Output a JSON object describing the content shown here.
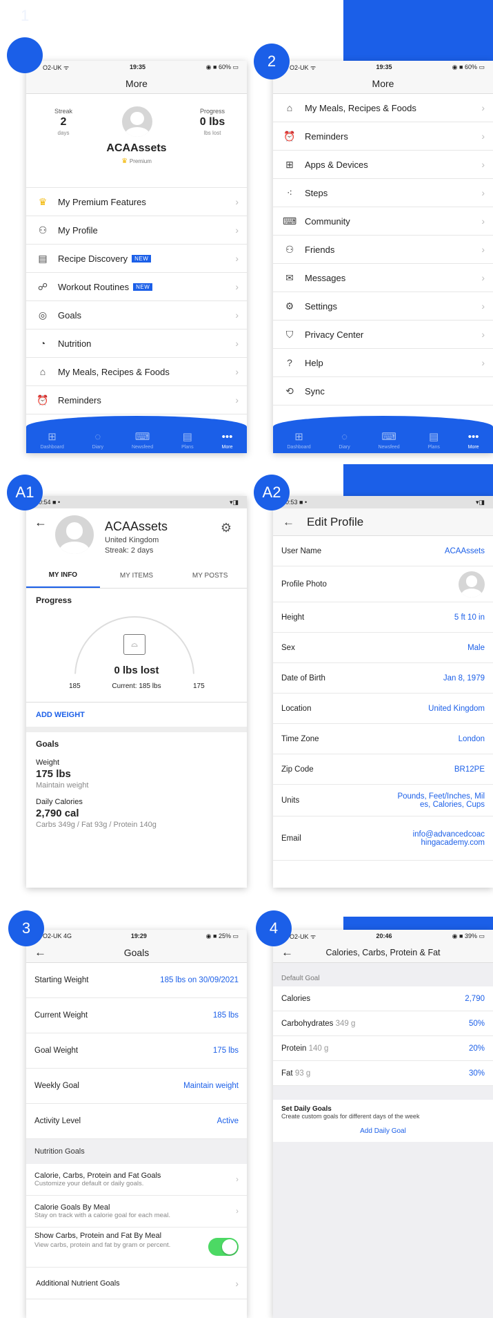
{
  "badges": {
    "b1": "",
    "b2": "2",
    "a1": "A1",
    "a2": "A2",
    "b3": "3",
    "b4": "4"
  },
  "corner_digit": "1",
  "colors": {
    "accent": "#1b5fe8",
    "toggle": "#4cd964"
  },
  "s1": {
    "status": {
      "left": "O2-UK ᯤ",
      "time": "19:35",
      "right": "◉ ■ 60% ▭"
    },
    "title": "More",
    "streak": {
      "label": "Streak",
      "value": "2",
      "unit": "days"
    },
    "progress": {
      "label": "Progress",
      "value": "0 lbs",
      "unit": "lbs lost"
    },
    "username": "ACAAssets",
    "premium": "Premium",
    "items": [
      {
        "icon": "crown-icon",
        "glyph": "♛",
        "label": "My Premium Features",
        "badge": ""
      },
      {
        "icon": "person-icon",
        "glyph": "⚇",
        "label": "My Profile",
        "badge": ""
      },
      {
        "icon": "recipe-icon",
        "glyph": "▤",
        "label": "Recipe Discovery",
        "badge": "NEW"
      },
      {
        "icon": "workout-icon",
        "glyph": "☍",
        "label": "Workout Routines",
        "badge": "NEW"
      },
      {
        "icon": "target-icon",
        "glyph": "◎",
        "label": "Goals",
        "badge": ""
      },
      {
        "icon": "nutrition-icon",
        "glyph": "◔",
        "label": "Nutrition",
        "badge": ""
      },
      {
        "icon": "house-icon",
        "glyph": "⌂",
        "label": "My Meals, Recipes & Foods",
        "badge": ""
      },
      {
        "icon": "alarm-icon",
        "glyph": "⏰",
        "label": "Reminders",
        "badge": ""
      }
    ]
  },
  "s2": {
    "status": {
      "left": "O2-UK ᯤ",
      "time": "19:35",
      "right": "◉ ■ 60% ▭"
    },
    "title": "More",
    "items": [
      {
        "icon": "house-icon",
        "glyph": "⌂",
        "label": "My Meals, Recipes & Foods"
      },
      {
        "icon": "alarm-icon",
        "glyph": "⏰",
        "label": "Reminders"
      },
      {
        "icon": "apps-icon",
        "glyph": "⊞",
        "label": "Apps & Devices"
      },
      {
        "icon": "steps-icon",
        "glyph": "⁖",
        "label": "Steps"
      },
      {
        "icon": "community-icon",
        "glyph": "⌨",
        "label": "Community"
      },
      {
        "icon": "friends-icon",
        "glyph": "⚇",
        "label": "Friends"
      },
      {
        "icon": "mail-icon",
        "glyph": "✉",
        "label": "Messages"
      },
      {
        "icon": "gear-icon",
        "glyph": "⚙",
        "label": "Settings"
      },
      {
        "icon": "shield-icon",
        "glyph": "⛉",
        "label": "Privacy Center"
      },
      {
        "icon": "help-icon",
        "glyph": "?",
        "label": "Help"
      },
      {
        "icon": "sync-icon",
        "glyph": "⟲",
        "label": "Sync"
      }
    ]
  },
  "tabs": [
    {
      "icon": "dashboard-icon",
      "glyph": "⊞",
      "label": "Dashboard"
    },
    {
      "icon": "diary-icon",
      "glyph": "◌",
      "label": "Diary"
    },
    {
      "icon": "newsfeed-icon",
      "glyph": "⌨",
      "label": "Newsfeed"
    },
    {
      "icon": "plans-icon",
      "glyph": "▤",
      "label": "Plans"
    },
    {
      "icon": "more-icon",
      "glyph": "•••",
      "label": "More"
    }
  ],
  "a1": {
    "status": {
      "left": "0:54 ■ •",
      "right": "▾◨"
    },
    "name": "ACAAssets",
    "country": "United Kingdom",
    "streak": "Streak: 2 days",
    "tabs": [
      "MY INFO",
      "MY ITEMS",
      "MY POSTS"
    ],
    "progress_title": "Progress",
    "lost": "0 lbs lost",
    "start": "185",
    "current": "Current: 185 lbs",
    "goal": "175",
    "add_weight": "ADD WEIGHT",
    "goals_title": "Goals",
    "weight_label": "Weight",
    "weight_value": "175 lbs",
    "weight_sub": "Maintain weight",
    "cal_label": "Daily Calories",
    "cal_value": "2,790 cal",
    "cal_sub": "Carbs 349g / Fat 93g / Protein 140g"
  },
  "a2": {
    "status": {
      "left": "0:53 ■ •",
      "right": "▾◨"
    },
    "title": "Edit Profile",
    "rows": [
      {
        "label": "User Name",
        "value": "ACAAssets"
      },
      {
        "label": "Profile Photo",
        "value": ""
      },
      {
        "label": "Height",
        "value": "5 ft 10 in"
      },
      {
        "label": "Sex",
        "value": "Male"
      },
      {
        "label": "Date of Birth",
        "value": "Jan 8, 1979"
      },
      {
        "label": "Location",
        "value": "United Kingdom"
      },
      {
        "label": "Time Zone",
        "value": "London"
      },
      {
        "label": "Zip Code",
        "value": "BR12PE"
      },
      {
        "label": "Units",
        "value": "Pounds, Feet/Inches, Miles, Calories, Cups"
      },
      {
        "label": "Email",
        "value": "info@advancedcoachingacademy.com"
      }
    ]
  },
  "s3": {
    "status": {
      "left": "O2-UK 4G",
      "time": "19:29",
      "right": "◉ ■ 25% ▭"
    },
    "title": "Goals",
    "rows": [
      {
        "label": "Starting Weight",
        "value": "185 lbs on 30/09/2021"
      },
      {
        "label": "Current Weight",
        "value": "185 lbs"
      },
      {
        "label": "Goal Weight",
        "value": "175 lbs"
      },
      {
        "label": "Weekly Goal",
        "value": "Maintain weight"
      },
      {
        "label": "Activity Level",
        "value": "Active"
      }
    ],
    "nutrition_header": "Nutrition Goals",
    "nrows": [
      {
        "title": "Calorie, Carbs, Protein and Fat Goals",
        "sub": "Customize your default or daily goals."
      },
      {
        "title": "Calorie Goals By Meal",
        "sub": "Stay on track with a calorie goal for each meal."
      }
    ],
    "toggle_title": "Show Carbs, Protein and Fat By Meal",
    "toggle_sub": "View carbs, protein and fat by gram or percent.",
    "toggle_on": true,
    "additional": "Additional Nutrient Goals"
  },
  "s4": {
    "status": {
      "left": "O2-UK ᯤ",
      "time": "20:46",
      "right": "◉ ■ 39% ▭"
    },
    "title": "Calories, Carbs, Protein & Fat",
    "default_goal": "Default Goal",
    "rows": [
      {
        "label": "Calories",
        "sub": "",
        "value": "2,790"
      },
      {
        "label": "Carbohydrates",
        "sub": "349 g",
        "value": "50%"
      },
      {
        "label": "Protein",
        "sub": "140 g",
        "value": "20%"
      },
      {
        "label": "Fat",
        "sub": "93 g",
        "value": "30%"
      }
    ],
    "set_daily": "Set Daily Goals",
    "set_daily_sub": "Create custom goals for different days of the week",
    "add_daily": "Add Daily Goal"
  }
}
